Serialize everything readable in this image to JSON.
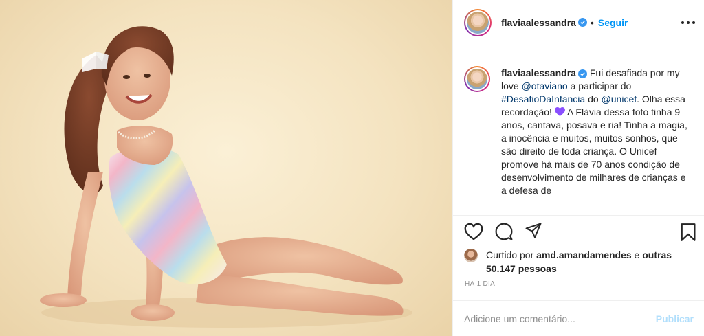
{
  "post": {
    "photo_subject": "girl-in-striped-swimsuit"
  },
  "header": {
    "username": "flaviaalessandra",
    "separator": "•",
    "follow_label": "Seguir"
  },
  "caption": {
    "username": "flaviaalessandra",
    "text_1": "Fui desafiada por my love ",
    "mention_1": "@otaviano",
    "text_2": " a participar do ",
    "hashtag": "#DesafioDaInfancia",
    "text_3": " do ",
    "mention_2": "@unicef",
    "text_4": ". Olha essa recordação! ",
    "text_5": " A Flávia dessa foto tinha 9 anos, cantava, posava e ria! Tinha a magia, a inocência e muitos, muitos sonhos, que são direito de toda criança. O Unicef promove há mais de 70 anos condição de desenvolvimento de milhares de crianças e a defesa de"
  },
  "likes": {
    "prefix": "Curtido por ",
    "liked_by": "amd.amandamendes",
    "middle": " e ",
    "others": "outras 50.147 pessoas"
  },
  "time_ago": "HÁ 1 DIA",
  "comment": {
    "placeholder": "Adicione um comentário...",
    "publish_label": "Publicar"
  },
  "colors": {
    "accent_blue": "#0095f6",
    "publish_disabled": "#b2dffc",
    "verified_blue": "#3897f0",
    "heart_purple": "#8a4fff",
    "border": "#efefef"
  }
}
